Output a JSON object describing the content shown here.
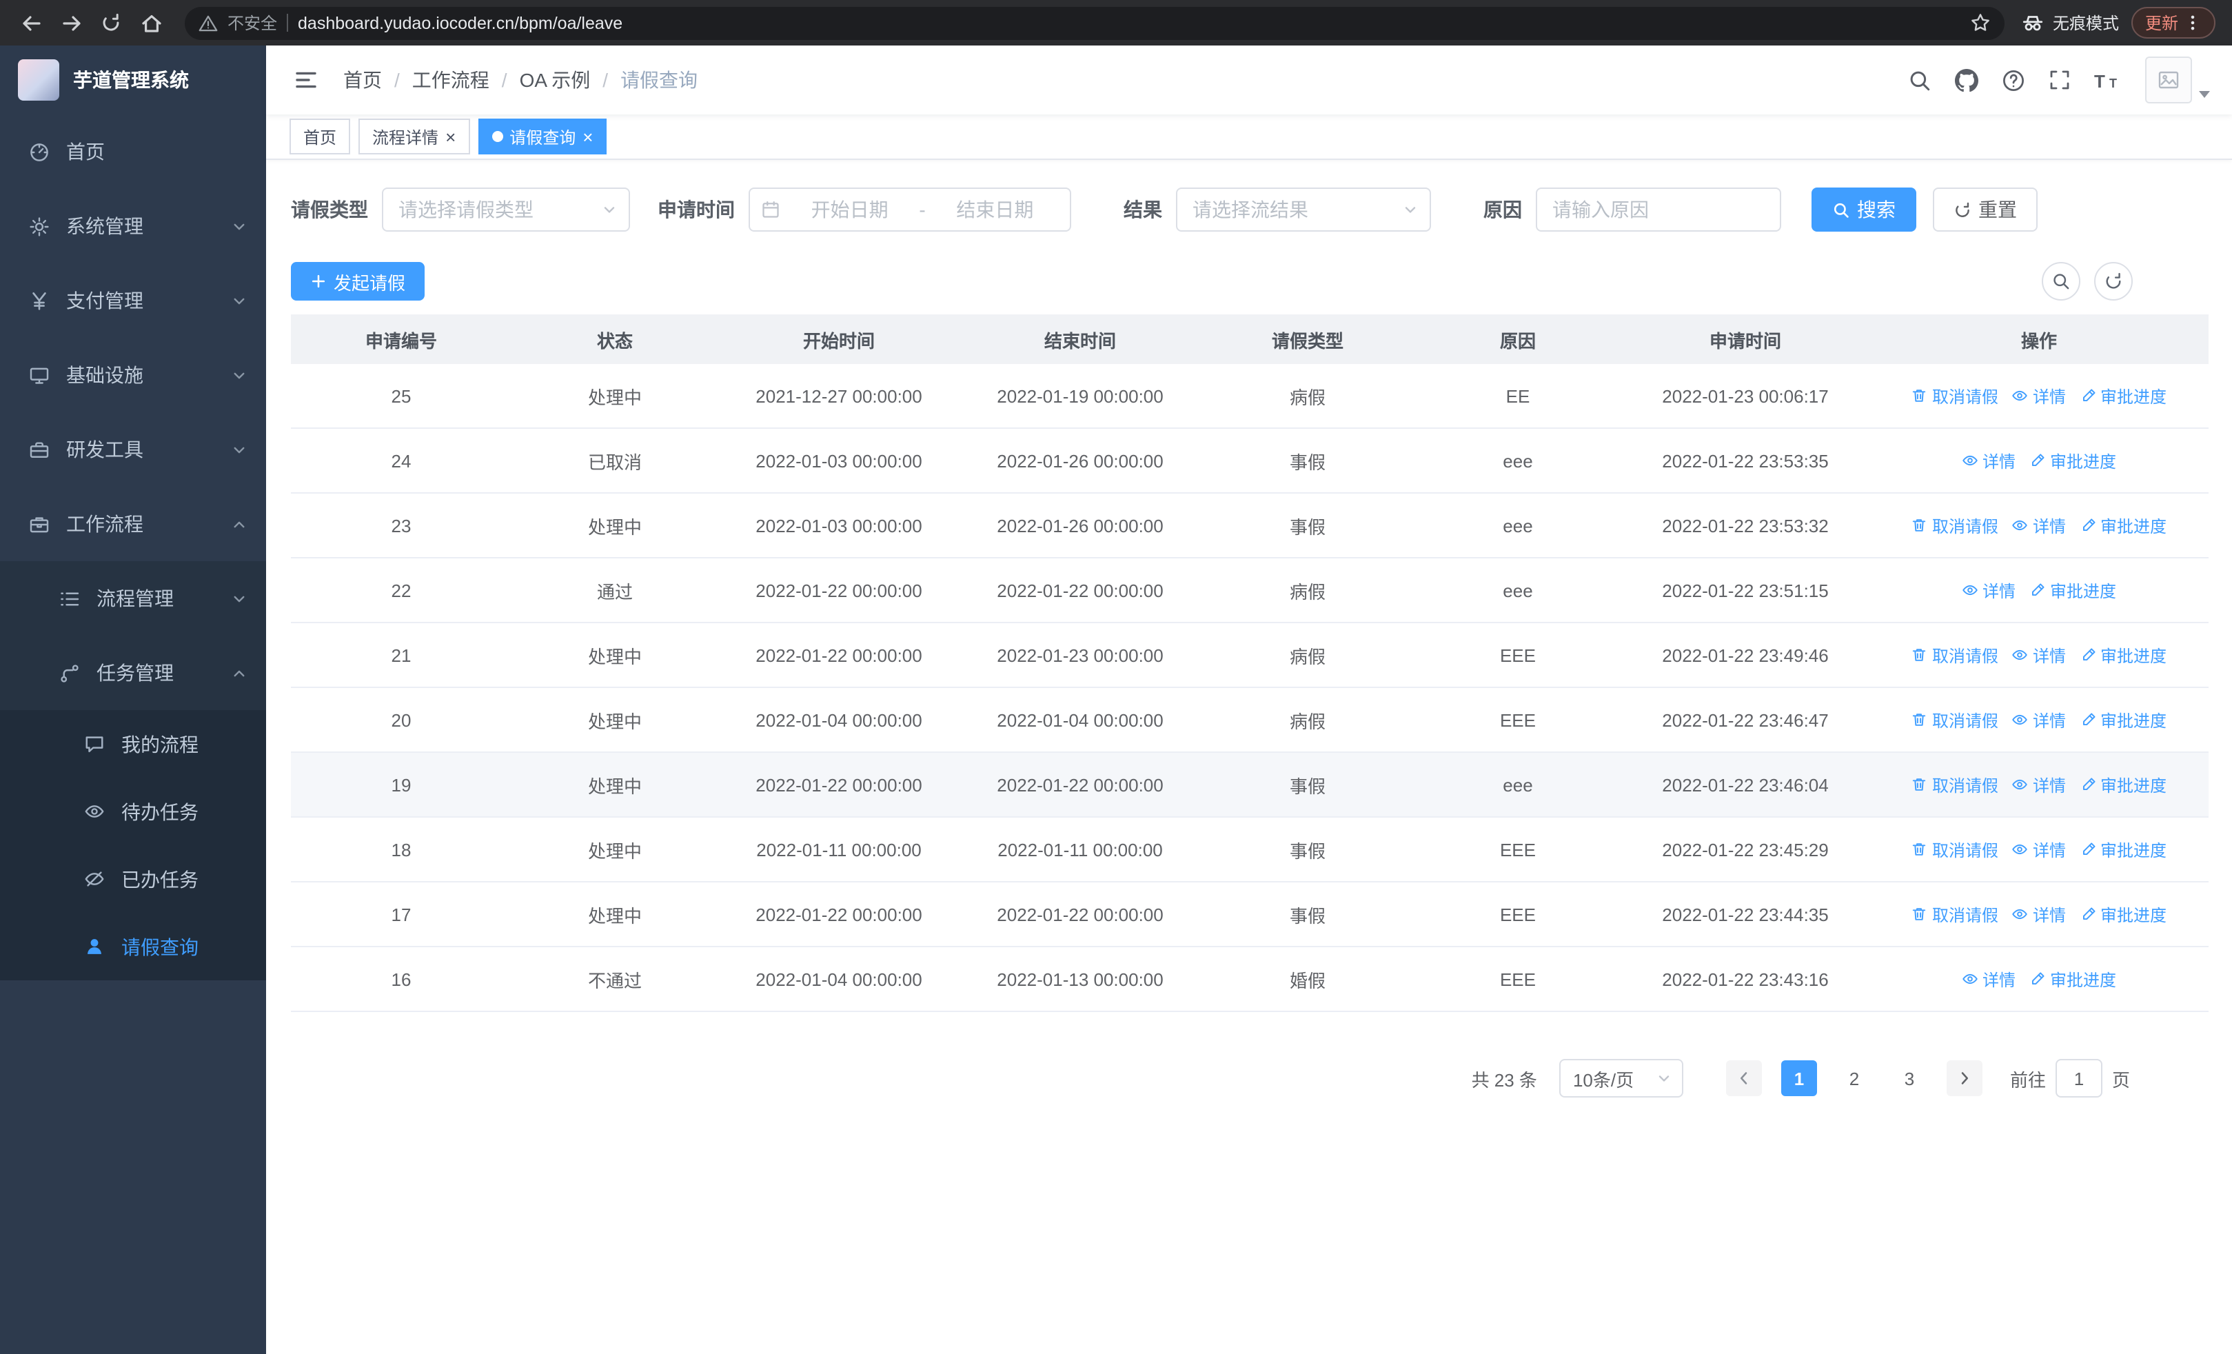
{
  "browser": {
    "security_label": "不安全",
    "url": "dashboard.yudao.iocoder.cn/bpm/oa/leave",
    "incognito_label": "无痕模式",
    "update_label": "更新"
  },
  "app": {
    "logo_title": "芋道管理系统"
  },
  "sidebar": {
    "items": [
      {
        "label": "首页",
        "icon": "dashboard-icon"
      },
      {
        "label": "系统管理",
        "icon": "gear-icon"
      },
      {
        "label": "支付管理",
        "icon": "yen-icon"
      },
      {
        "label": "基础设施",
        "icon": "monitor-icon"
      },
      {
        "label": "研发工具",
        "icon": "toolbox-icon"
      },
      {
        "label": "工作流程",
        "icon": "briefcase-icon"
      }
    ],
    "process_mgmt": "流程管理",
    "task_mgmt": "任务管理",
    "my_process": "我的流程",
    "todo_tasks": "待办任务",
    "done_tasks": "已办任务",
    "leave_query": "请假查询"
  },
  "breadcrumb": {
    "separator": "/",
    "items": [
      "首页",
      "工作流程",
      "OA 示例",
      "请假查询"
    ]
  },
  "tabs": [
    {
      "label": "首页"
    },
    {
      "label": "流程详情"
    },
    {
      "label": "请假查询"
    }
  ],
  "filters": {
    "leave_type_label": "请假类型",
    "leave_type_placeholder": "请选择请假类型",
    "apply_time_label": "申请时间",
    "start_date_placeholder": "开始日期",
    "date_separator": "-",
    "end_date_placeholder": "结束日期",
    "result_label": "结果",
    "result_placeholder": "请选择流结果",
    "reason_label": "原因",
    "reason_placeholder": "请输入原因",
    "search_button": "搜索",
    "reset_button": "重置"
  },
  "toolbar": {
    "create_button": "发起请假"
  },
  "table": {
    "headers": [
      "申请编号",
      "状态",
      "开始时间",
      "结束时间",
      "请假类型",
      "原因",
      "申请时间",
      "操作"
    ],
    "action_labels": {
      "cancel": "取消请假",
      "detail": "详情",
      "progress": "审批进度"
    },
    "rows": [
      {
        "id": "25",
        "status": "处理中",
        "start": "2021-12-27 00:00:00",
        "end": "2022-01-19 00:00:00",
        "type": "病假",
        "reason": "EE",
        "applied": "2022-01-23 00:06:17",
        "actions": [
          "cancel",
          "detail",
          "progress"
        ]
      },
      {
        "id": "24",
        "status": "已取消",
        "start": "2022-01-03 00:00:00",
        "end": "2022-01-26 00:00:00",
        "type": "事假",
        "reason": "eee",
        "applied": "2022-01-22 23:53:35",
        "actions": [
          "detail",
          "progress"
        ]
      },
      {
        "id": "23",
        "status": "处理中",
        "start": "2022-01-03 00:00:00",
        "end": "2022-01-26 00:00:00",
        "type": "事假",
        "reason": "eee",
        "applied": "2022-01-22 23:53:32",
        "actions": [
          "cancel",
          "detail",
          "progress"
        ]
      },
      {
        "id": "22",
        "status": "通过",
        "start": "2022-01-22 00:00:00",
        "end": "2022-01-22 00:00:00",
        "type": "病假",
        "reason": "eee",
        "applied": "2022-01-22 23:51:15",
        "actions": [
          "detail",
          "progress"
        ]
      },
      {
        "id": "21",
        "status": "处理中",
        "start": "2022-01-22 00:00:00",
        "end": "2022-01-23 00:00:00",
        "type": "病假",
        "reason": "EEE",
        "applied": "2022-01-22 23:49:46",
        "actions": [
          "cancel",
          "detail",
          "progress"
        ]
      },
      {
        "id": "20",
        "status": "处理中",
        "start": "2022-01-04 00:00:00",
        "end": "2022-01-04 00:00:00",
        "type": "病假",
        "reason": "EEE",
        "applied": "2022-01-22 23:46:47",
        "actions": [
          "cancel",
          "detail",
          "progress"
        ]
      },
      {
        "id": "19",
        "status": "处理中",
        "start": "2022-01-22 00:00:00",
        "end": "2022-01-22 00:00:00",
        "type": "事假",
        "reason": "eee",
        "applied": "2022-01-22 23:46:04",
        "actions": [
          "cancel",
          "detail",
          "progress"
        ],
        "highlighted": true
      },
      {
        "id": "18",
        "status": "处理中",
        "start": "2022-01-11 00:00:00",
        "end": "2022-01-11 00:00:00",
        "type": "事假",
        "reason": "EEE",
        "applied": "2022-01-22 23:45:29",
        "actions": [
          "cancel",
          "detail",
          "progress"
        ]
      },
      {
        "id": "17",
        "status": "处理中",
        "start": "2022-01-22 00:00:00",
        "end": "2022-01-22 00:00:00",
        "type": "事假",
        "reason": "EEE",
        "applied": "2022-01-22 23:44:35",
        "actions": [
          "cancel",
          "detail",
          "progress"
        ]
      },
      {
        "id": "16",
        "status": "不通过",
        "start": "2022-01-04 00:00:00",
        "end": "2022-01-13 00:00:00",
        "type": "婚假",
        "reason": "EEE",
        "applied": "2022-01-22 23:43:16",
        "actions": [
          "detail",
          "progress"
        ]
      }
    ]
  },
  "pagination": {
    "total_label": "共 23 条",
    "page_size": "10条/页",
    "pages": [
      "1",
      "2",
      "3"
    ],
    "active_page": "1",
    "goto_label": "前往",
    "goto_value": "1",
    "page_unit": "页"
  },
  "colors": {
    "accent": "#409eff",
    "sidebar_bg": "#2d3a4d",
    "tab_active": "#409eff"
  }
}
